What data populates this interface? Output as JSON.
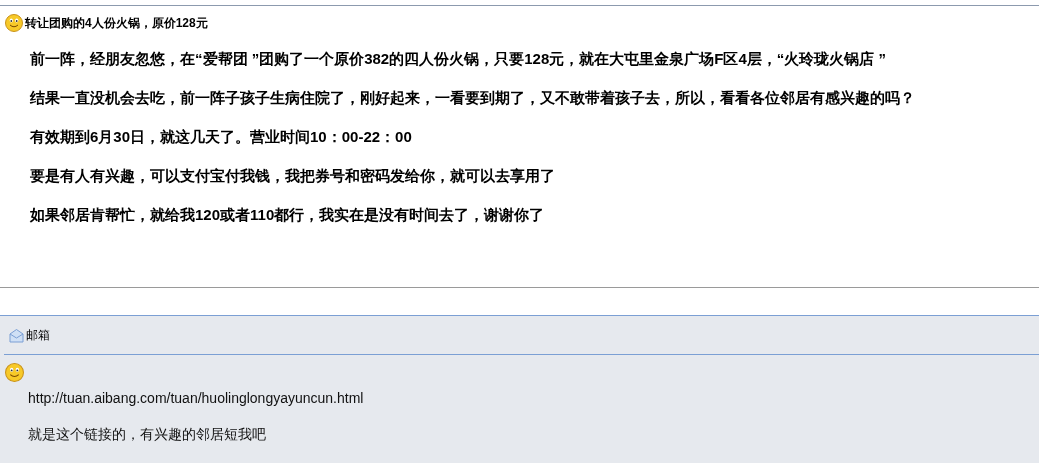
{
  "post": {
    "title": "转让团购的4人份火锅，原价128元",
    "paragraphs": [
      "前一阵，经朋友忽悠，在“爱帮团 ”团购了一个原价382的四人份火锅，只要128元，就在大屯里金泉广场F区4层，“火玲珑火锅店 ”",
      "结果一直没机会去吃，前一阵子孩子生病住院了，刚好起来，一看要到期了，又不敢带着孩子去，所以，看看各位邻居有感兴趣的吗？",
      "有效期到6月30日，就这几天了。营业时间10：00-22：00",
      "要是有人有兴趣，可以支付宝付我钱，我把券号和密码发给你，就可以去享用了",
      "如果邻居肯帮忙，就给我120或者110都行，我实在是没有时间去了，谢谢你了"
    ]
  },
  "reply": {
    "mailbox": "邮箱",
    "link": "http://tuan.aibang.com/tuan/huolinglongyayuncun.html",
    "text": "就是这个链接的，有兴趣的邻居短我吧"
  }
}
